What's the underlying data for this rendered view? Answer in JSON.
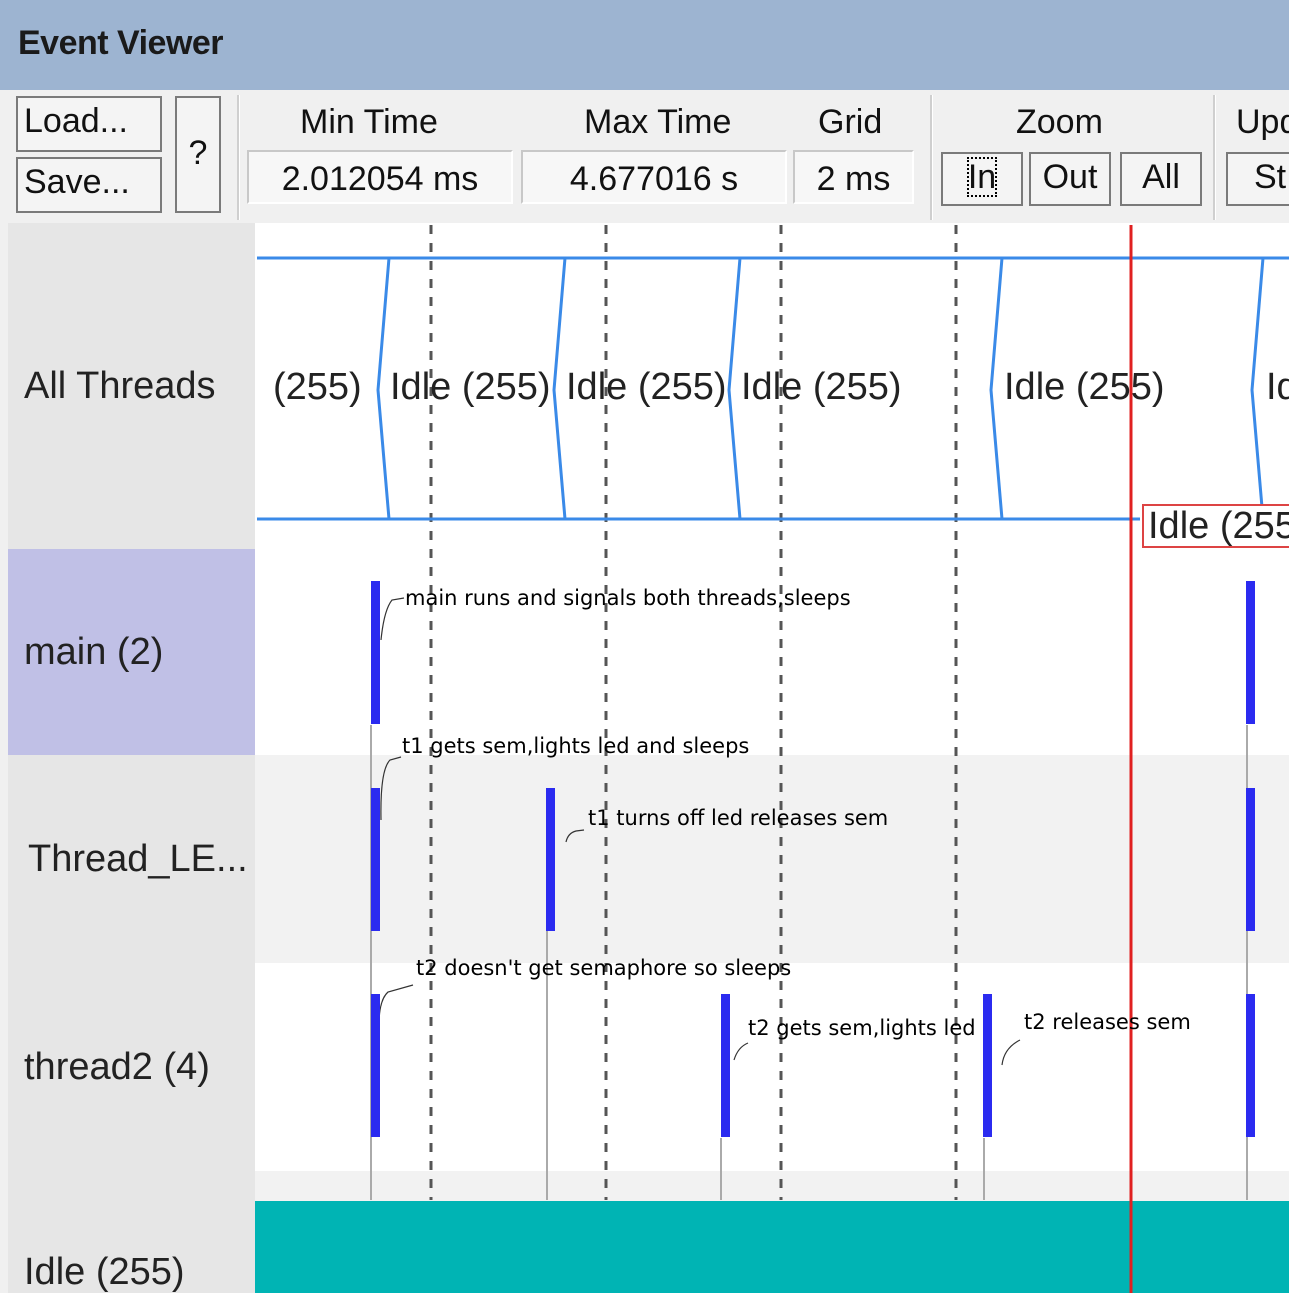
{
  "window": {
    "title": "Event Viewer"
  },
  "toolbar": {
    "load_label": "Load...",
    "save_label": "Save...",
    "help_label": "?",
    "min_time_label": "Min Time",
    "min_time_value": "2.012054 ms",
    "max_time_label": "Max Time",
    "max_time_value": "4.677016 s",
    "grid_label": "Grid",
    "grid_value": "2 ms",
    "zoom_label": "Zoom",
    "zoom_in_label": "In",
    "zoom_out_label": "Out",
    "zoom_all_label": "All",
    "update_label": "Upd",
    "update_button_label": "St"
  },
  "rows": {
    "all_threads": "All Threads",
    "main": "main (2)",
    "thread_led": "Thread_LE...",
    "thread2": "thread2 (4)",
    "idle": "Idle (255)"
  },
  "all_threads_segments": [
    "(255)",
    "Idle (255)",
    "Idle (255)",
    "Idle (255)",
    "Idle (255)",
    "Id"
  ],
  "cursor_label": "Idle (255",
  "annotations": {
    "main": "main runs and signals both threads,sleeps",
    "t1_gets": "t1 gets sem,lights led and sleeps",
    "t1_off": "t1 turns off led releases sem",
    "t2_sleeps": "t2 doesn't get semaphore so sleeps",
    "t2_gets": "t2 gets sem,lights led",
    "t2_releases": "t2 releases sem"
  },
  "colors": {
    "title_bar": "#9db4d1",
    "thread_run": "#2b2bf0",
    "idle_fill": "#00b4b4",
    "segment_line": "#3a8ae8",
    "cursor": "#e02020",
    "selected_row": "#c0c0e6"
  }
}
